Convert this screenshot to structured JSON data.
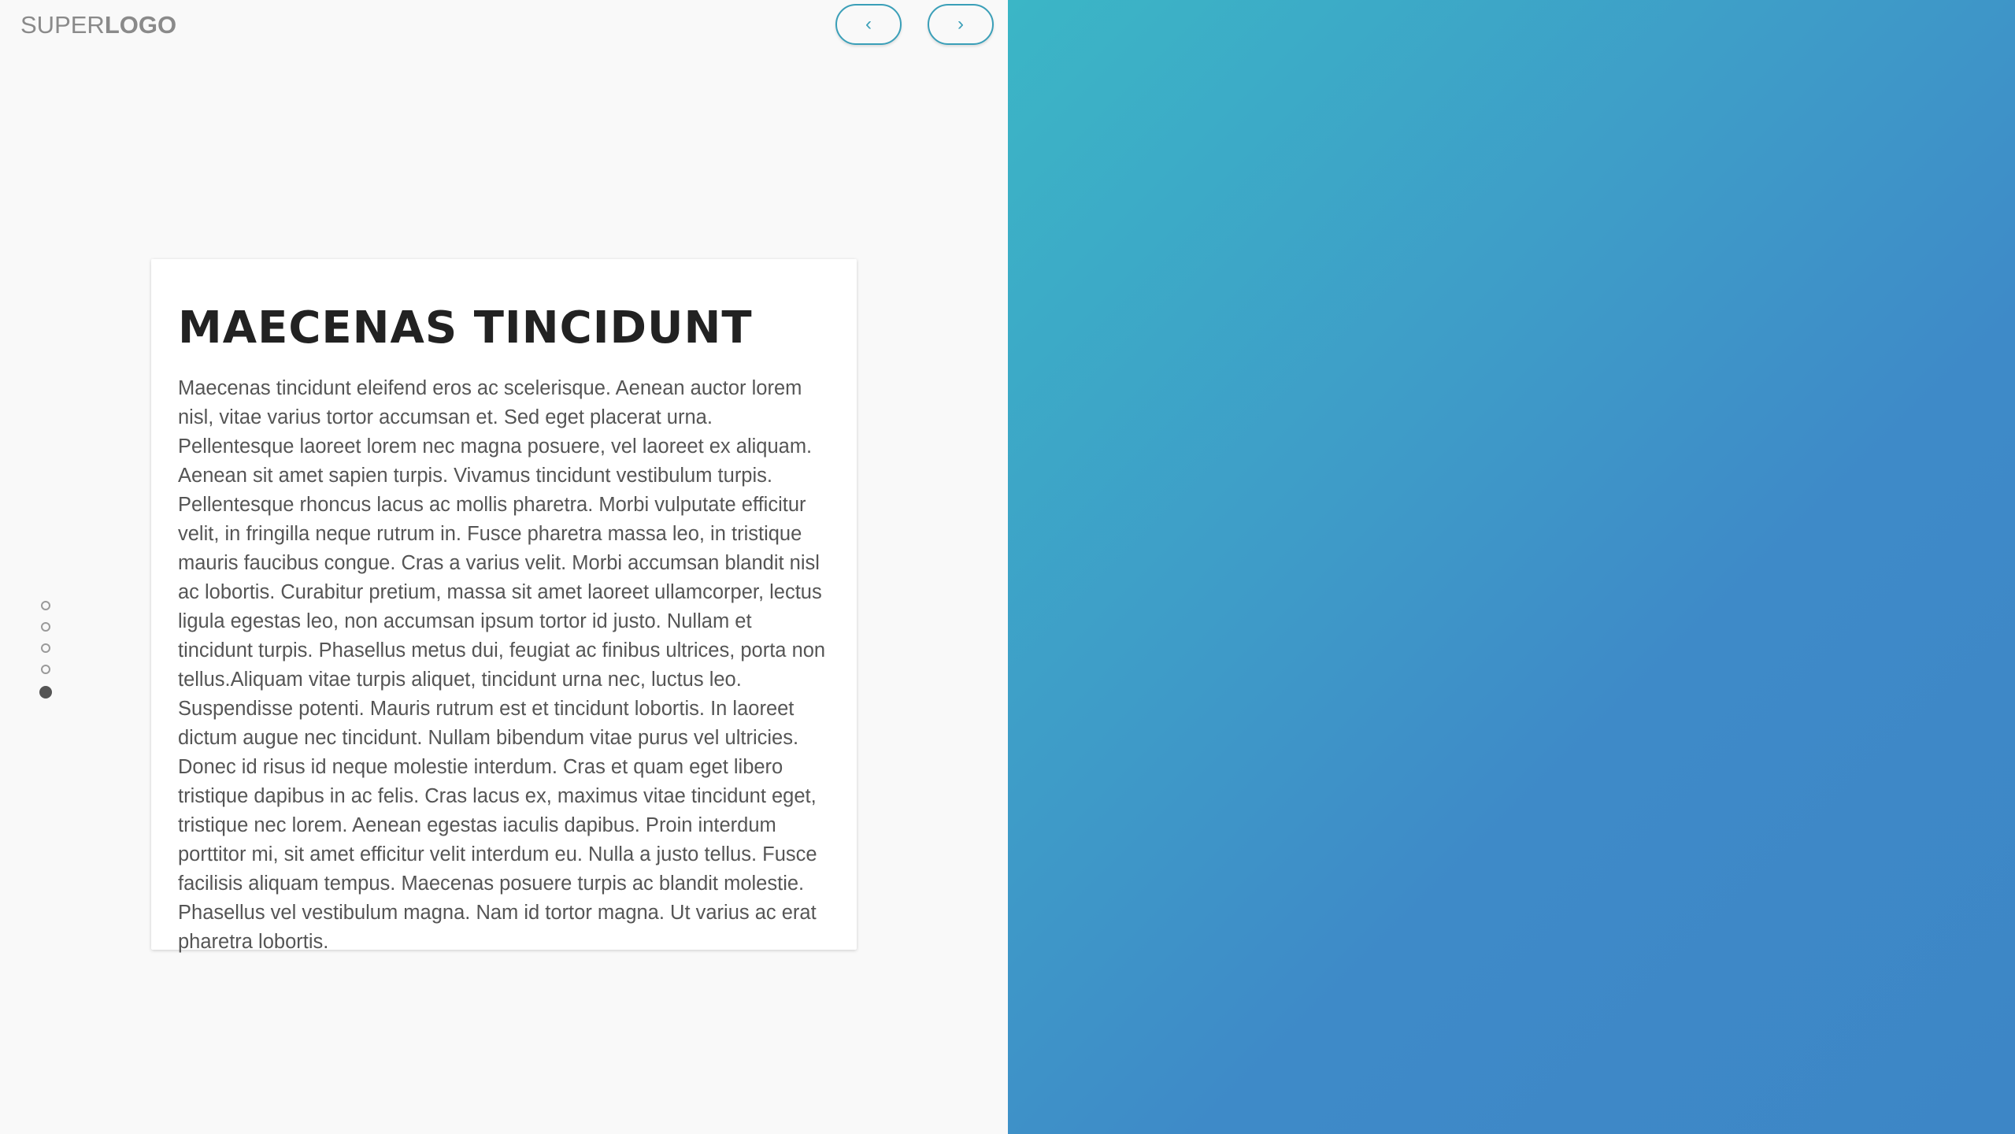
{
  "logo": {
    "light": "SUPER",
    "bold": "LOGO"
  },
  "nav": {
    "prev_label": "‹",
    "next_label": "›"
  },
  "pagination": {
    "total": 5,
    "active_index": 5
  },
  "card": {
    "title": "MAECENAS TINCIDUNT",
    "body": "Maecenas tincidunt eleifend eros ac scelerisque. Aenean auctor lorem nisl, vitae varius tortor accumsan et. Sed eget placerat urna. Pellentesque laoreet lorem nec magna posuere, vel laoreet ex aliquam. Aenean sit amet sapien turpis. Vivamus tincidunt vestibulum turpis. Pellentesque rhoncus lacus ac mollis pharetra. Morbi vulputate efficitur velit, in fringilla neque rutrum in. Fusce pharetra massa leo, in tristique mauris faucibus congue. Cras a varius velit. Morbi accumsan blandit nisl ac lobortis. Curabitur pretium, massa sit amet laoreet ullamcorper, lectus ligula egestas leo, non accumsan ipsum tortor id justo. Nullam et tincidunt turpis. Phasellus metus dui, feugiat ac finibus ultrices, porta non tellus.Aliquam vitae turpis aliquet, tincidunt urna nec, luctus leo. Suspendisse potenti. Mauris rutrum est et tincidunt lobortis. In laoreet dictum augue nec tincidunt. Nullam bibendum vitae purus vel ultricies. Donec id risus id neque molestie interdum. Cras et quam eget libero tristique dapibus in ac felis. Cras lacus ex, maximus vitae tincidunt eget, tristique nec lorem. Aenean egestas iaculis dapibus. Proin interdum porttitor mi, sit amet efficitur velit interdum eu. Nulla a justo tellus. Fusce facilisis aliquam tempus. Maecenas posuere turpis ac blandit molestie. Phasellus vel vestibulum magna. Nam id tortor magna. Ut varius ac erat pharetra lobortis."
  },
  "colors": {
    "accent": "#3a9fb8",
    "gradient_start": "#3bb6c6",
    "gradient_end": "#3d86c6",
    "left_background": "#f9f9f9",
    "title_text": "#222222",
    "body_text": "#555555"
  }
}
